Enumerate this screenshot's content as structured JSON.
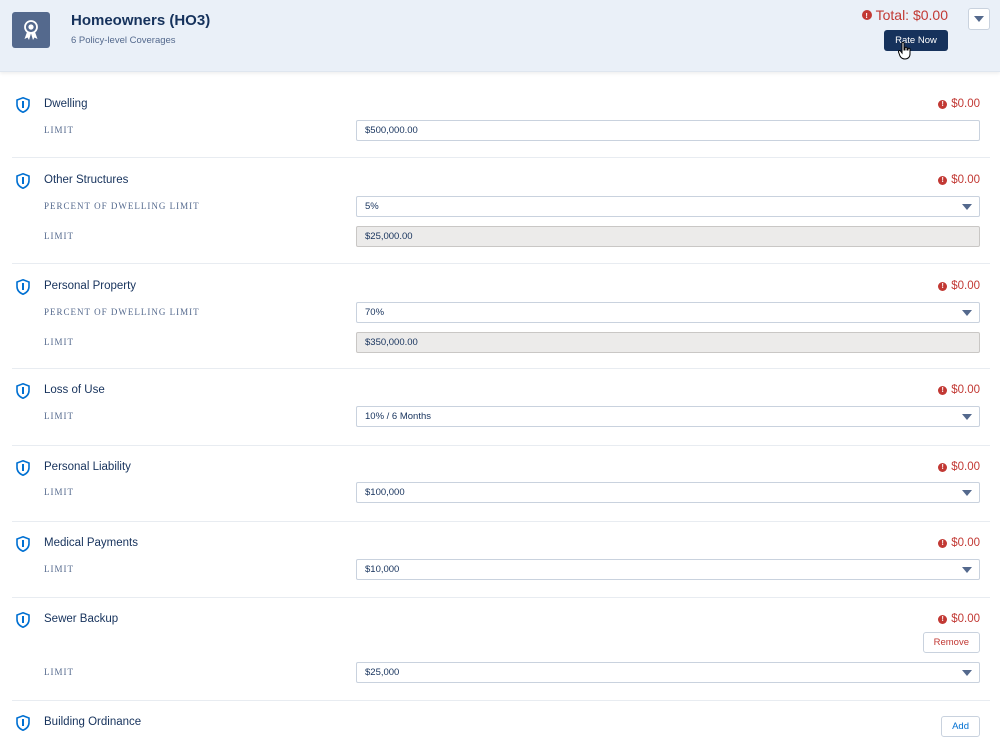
{
  "header": {
    "title": "Homeowners (HO3)",
    "subtitle": "6 Policy-level Coverages",
    "total": "Total: $0.00",
    "rate_button": "Rate Now",
    "icon": "award-icon",
    "menu_icon": "chevron-down-icon"
  },
  "colors": {
    "header_bg": "#eaf0f8",
    "primary": "#16325c",
    "error": "#c23934",
    "link": "#0070d2",
    "readonly_bg": "#ecebea"
  },
  "sections": [
    {
      "title": "Dwelling",
      "amount": "$0.00",
      "fields": [
        {
          "label": "LIMIT",
          "value": "$500,000.00",
          "type": "text"
        }
      ]
    },
    {
      "title": "Other Structures",
      "amount": "$0.00",
      "fields": [
        {
          "label": "PERCENT OF DWELLING LIMIT",
          "value": "5%",
          "type": "select"
        },
        {
          "label": "LIMIT",
          "value": "$25,000.00",
          "type": "readonly"
        }
      ]
    },
    {
      "title": "Personal Property",
      "amount": "$0.00",
      "fields": [
        {
          "label": "PERCENT OF DWELLING LIMIT",
          "value": "70%",
          "type": "select"
        },
        {
          "label": "LIMIT",
          "value": "$350,000.00",
          "type": "readonly"
        }
      ]
    },
    {
      "title": "Loss of Use",
      "amount": "$0.00",
      "fields": [
        {
          "label": "LIMIT",
          "value": "10% / 6 Months",
          "type": "select"
        }
      ]
    },
    {
      "title": "Personal Liability",
      "amount": "$0.00",
      "fields": [
        {
          "label": "LIMIT",
          "value": "$100,000",
          "type": "select"
        }
      ]
    },
    {
      "title": "Medical Payments",
      "amount": "$0.00",
      "fields": [
        {
          "label": "LIMIT",
          "value": "$10,000",
          "type": "select"
        }
      ]
    },
    {
      "title": "Sewer Backup",
      "amount": "$0.00",
      "button": "Remove",
      "fields": [
        {
          "label": "LIMIT",
          "value": "$25,000",
          "type": "select"
        }
      ]
    },
    {
      "title": "Building Ordinance",
      "button": "Add"
    }
  ]
}
